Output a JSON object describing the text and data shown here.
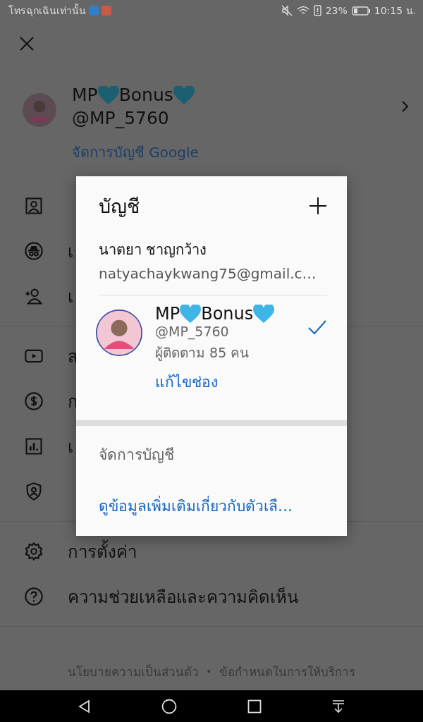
{
  "status_bar": {
    "carrier_text": "โทรฉุกเฉินเท่านั้น",
    "battery_text": "23%",
    "time": "10:15 น."
  },
  "header": {
    "name_parts": [
      "MP",
      "Bonus"
    ],
    "handle": "@MP_5760",
    "manage_link": "จัดการบัญชี Google"
  },
  "menu_sections": [
    [
      {
        "kind": "channel"
      },
      {
        "kind": "incognito",
        "label": "เ"
      },
      {
        "kind": "add-account",
        "label": "เ"
      }
    ],
    [
      {
        "kind": "video",
        "label": "ส"
      },
      {
        "kind": "money",
        "label": "ก"
      },
      {
        "kind": "stats",
        "label": "เ"
      },
      {
        "kind": "privacy"
      }
    ],
    [
      {
        "kind": "settings",
        "label": "การตั้งค่า"
      },
      {
        "kind": "help",
        "label": "ความช่วยเหลือและความคิดเห็น"
      }
    ]
  ],
  "dialog": {
    "title": "บัญชี",
    "other_account": {
      "name": "นาตยา ชาญกว้าง",
      "email": "natyachaykwang75@gmail.c…"
    },
    "current_account": {
      "name_parts": [
        "MP",
        "Bonus"
      ],
      "handle": "@MP_5760",
      "followers": "ผู้ติดตาม 85 คน",
      "edit_link": "แก้ไขช่อง",
      "selected": true
    },
    "manage_title": "จัดการบัญชี",
    "more_link": "ดูข้อมูลเพิ่มเติมเกี่ยวกับตัวเลื…"
  },
  "footer": {
    "links": [
      "นโยบายความเป็นส่วนตัว",
      "ข้อกำหนดในการให้บริการ"
    ],
    "separator": "•"
  }
}
